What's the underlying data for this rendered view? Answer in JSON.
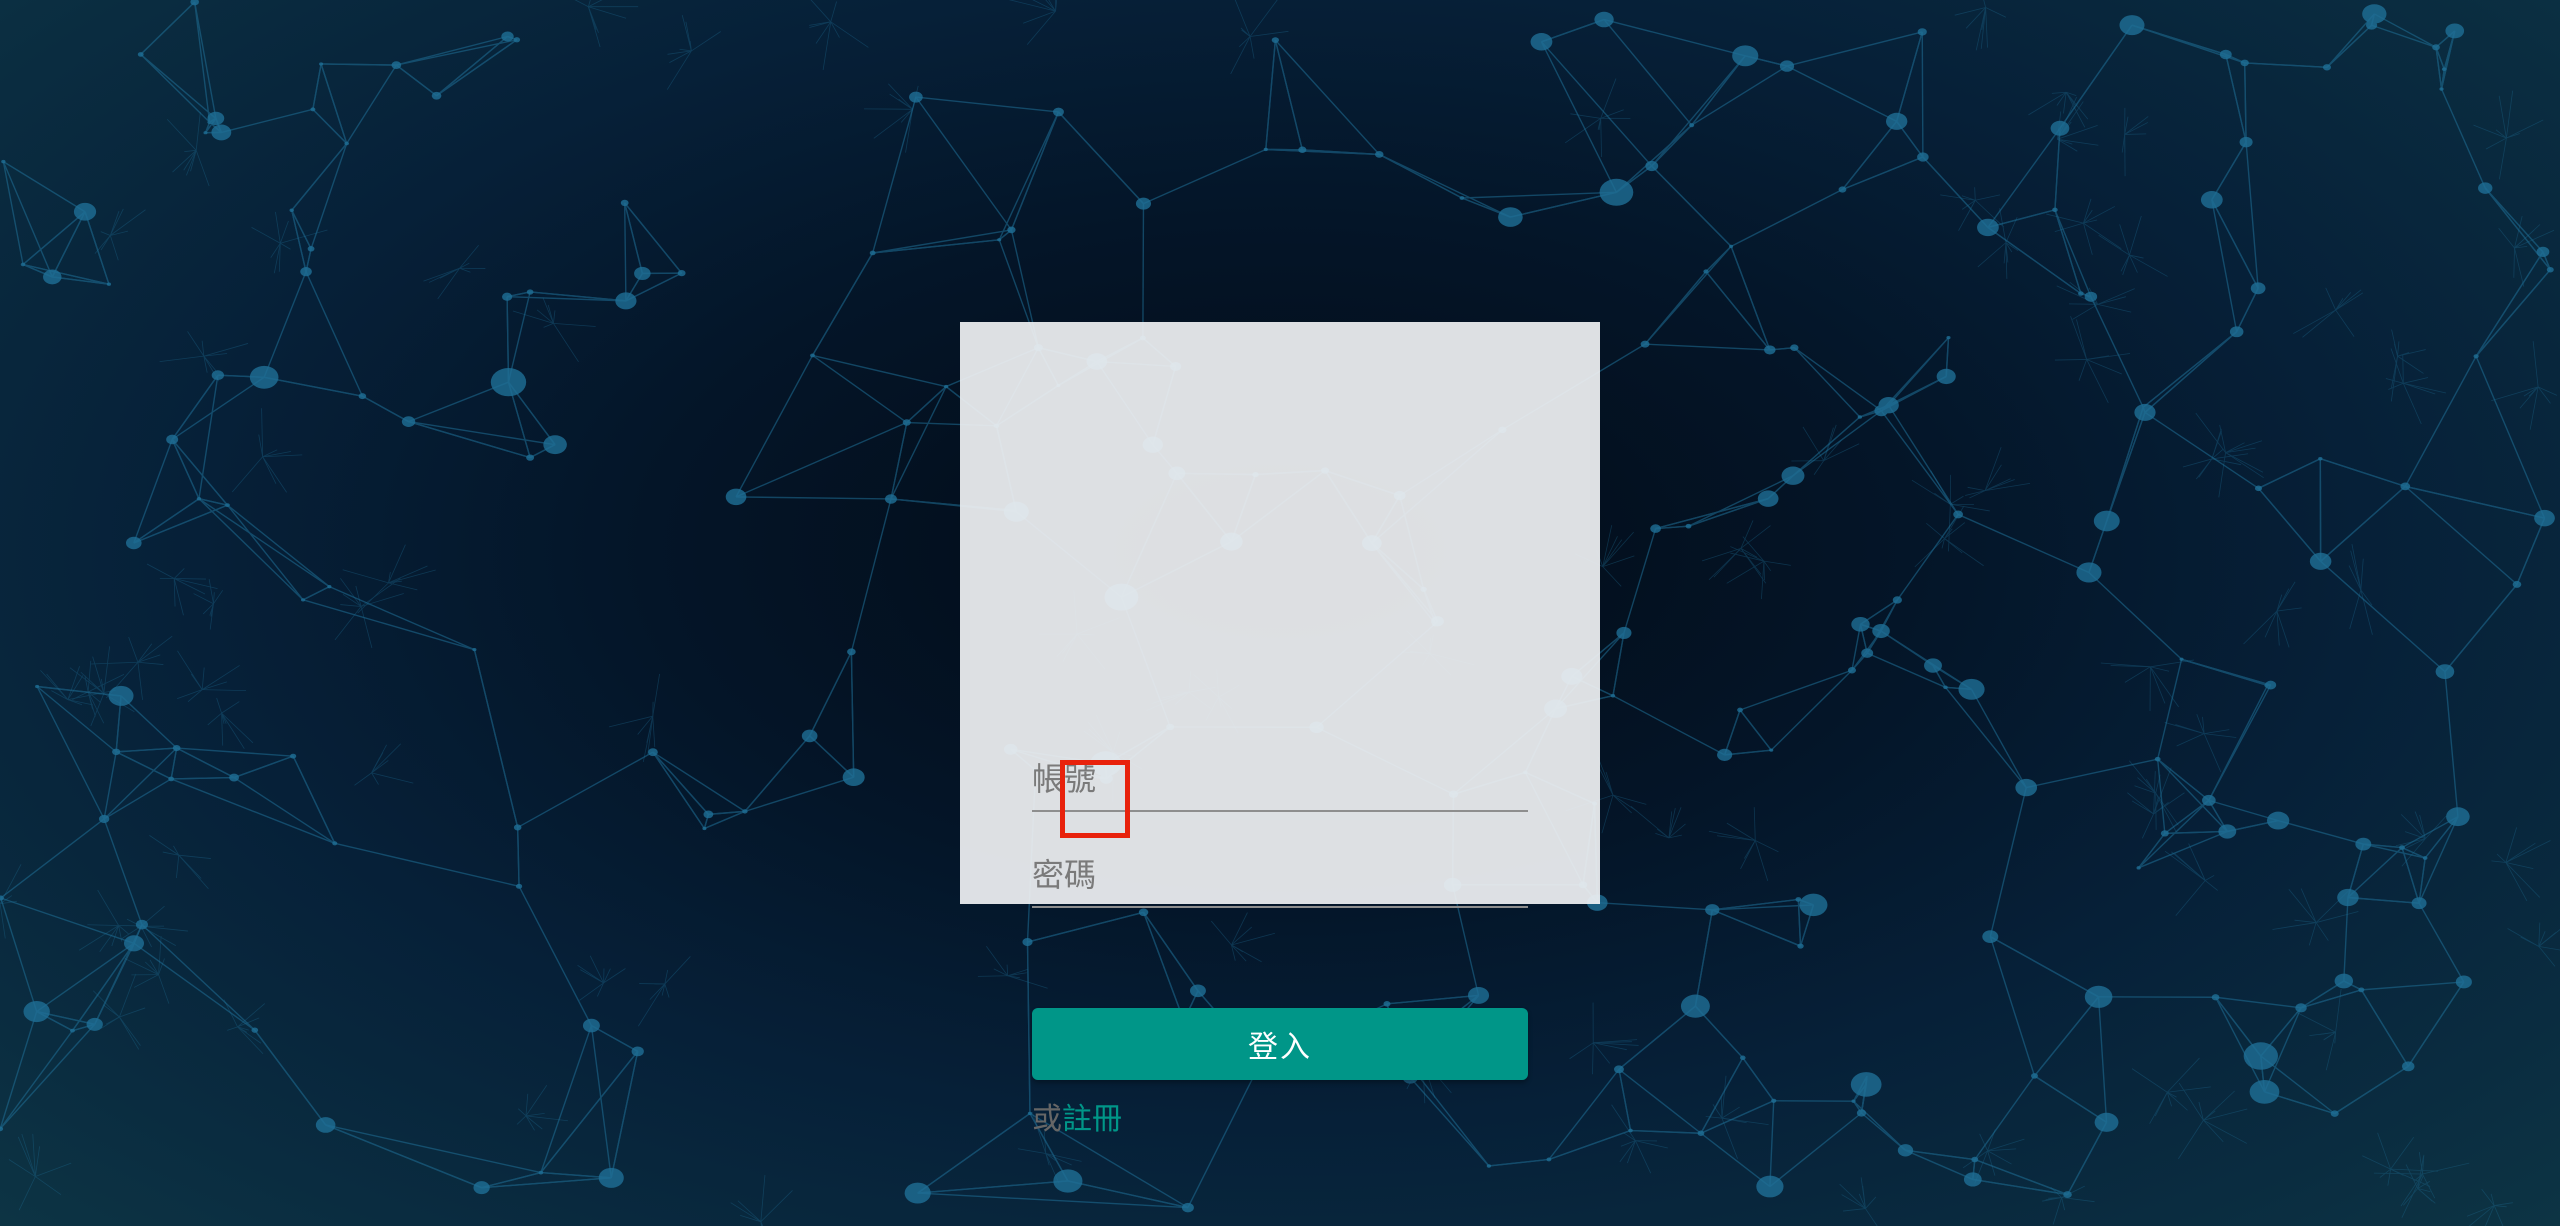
{
  "login_form": {
    "account_placeholder": "帳號",
    "password_placeholder": "密碼",
    "login_label": "登入",
    "or_text": "或",
    "register_label": "註冊"
  },
  "colors": {
    "accent": "#009688",
    "highlight": "#e8220c",
    "card_background": "#eef0f2",
    "background_dark": "#041528",
    "network_lines": "#1f6f96"
  },
  "background": {
    "decoration": "network-mesh-pattern"
  }
}
